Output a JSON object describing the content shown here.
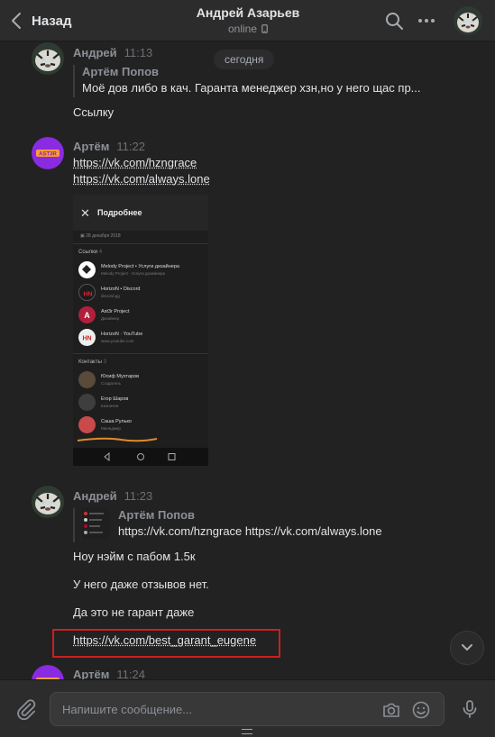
{
  "header": {
    "back_label": "Назад",
    "title": "Андрей Азарьев",
    "status": "online"
  },
  "date_separator": "сегодня",
  "messages": [
    {
      "author": "Андрей",
      "time": "11:13",
      "reply_author": "Артём Попов",
      "reply_text": "Моё дов либо в кач. Гаранта менеджер хзн,но у него щас пр...",
      "text": "Ссылку"
    },
    {
      "author": "Артём",
      "time": "11:22",
      "links": [
        "https://vk.com/hzngrace",
        "https://vk.com/always.lone"
      ],
      "attachment": {
        "title": "Подробнее",
        "date": "28 декабря 2018",
        "links_label": "Ссылки",
        "links_count": "4",
        "links": [
          {
            "title": "Melody Project • Услуги дизайнера",
            "subtitle": "Melody Project - Услуги дизайнера"
          },
          {
            "title": "HorizoN • Discord",
            "subtitle": "discord.gg"
          },
          {
            "title": "Ast3r Project",
            "subtitle": "Дизайнер"
          },
          {
            "title": "HorizoN · YouTube",
            "subtitle": "www.youtube.com"
          }
        ],
        "contacts_label": "Контакты",
        "contacts_count": "3",
        "contacts": [
          {
            "title": "Юсиф Мухтаров",
            "subtitle": "Создатель"
          },
          {
            "title": "Егор Шаров",
            "subtitle": "Казначеи"
          },
          {
            "title": "Саша Рулько",
            "subtitle": "Менеджер"
          }
        ]
      }
    },
    {
      "author": "Андрей",
      "time": "11:23",
      "reply_author": "Артём Попов",
      "reply_text": "https://vk.com/hzngrace https://vk.com/always.lone",
      "lines": [
        "Ноу нэйм с пабом 1.5к",
        "У него даже отзывов нет.",
        "Да это не гарант даже"
      ],
      "link": "https://vk.com/best_garant_eugene"
    },
    {
      "author": "Артём",
      "time": "11:24"
    }
  ],
  "composer": {
    "placeholder": "Напишите сообщение..."
  },
  "colors": {
    "background": "#222222",
    "header": "#2c2c2c",
    "highlight": "#cc1f1f",
    "artem_avatar": "#8a2be2"
  }
}
